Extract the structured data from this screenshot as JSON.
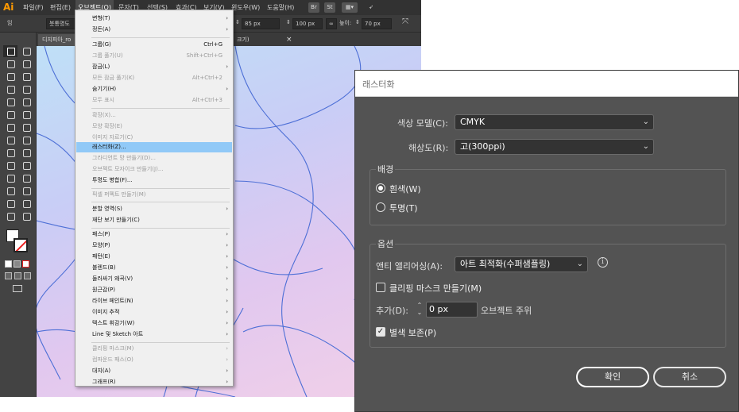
{
  "app": {
    "logo": "Ai"
  },
  "menubar": {
    "items": [
      "파일(F)",
      "편집(E)",
      "오브젝트(O)",
      "문자(T)",
      "선택(S)",
      "효과(C)",
      "보기(V)",
      "윈도우(W)",
      "도움말(H)"
    ],
    "icons": [
      "Br",
      "St"
    ]
  },
  "controlbar": {
    "label": "임",
    "brush": "붓통명도",
    "width_value": "85 px",
    "size_value": "100 px",
    "height_label": "높이:",
    "height_value": "70 px"
  },
  "tabs": {
    "doc_title": "디지피아_ro",
    "doc_suffix": "8)",
    "other_tab": "크기)"
  },
  "object_menu": {
    "items": [
      {
        "label": "변형(T)",
        "shortcut": "",
        "arrow": true,
        "disabled": false
      },
      {
        "label": "정돈(A)",
        "shortcut": "",
        "arrow": true,
        "disabled": false
      },
      {
        "label": "그룹(G)",
        "shortcut": "Ctrl+G",
        "arrow": false,
        "disabled": false
      },
      {
        "label": "그룹 풀기(U)",
        "shortcut": "Shift+Ctrl+G",
        "arrow": false,
        "disabled": true
      },
      {
        "label": "잠금(L)",
        "shortcut": "",
        "arrow": true,
        "disabled": false
      },
      {
        "label": "모든 잠금 풀기(K)",
        "shortcut": "Alt+Ctrl+2",
        "arrow": false,
        "disabled": true
      },
      {
        "label": "숨기기(H)",
        "shortcut": "",
        "arrow": true,
        "disabled": false
      },
      {
        "label": "모두 표시",
        "shortcut": "Alt+Ctrl+3",
        "arrow": false,
        "disabled": true
      },
      {
        "label": "확장(X)...",
        "shortcut": "",
        "arrow": false,
        "disabled": true
      },
      {
        "label": "모양 확장(E)",
        "shortcut": "",
        "arrow": false,
        "disabled": true
      },
      {
        "label": "이미지 자르기(C)",
        "shortcut": "",
        "arrow": false,
        "disabled": true
      },
      {
        "label": "래스터화(Z)...",
        "shortcut": "",
        "arrow": false,
        "disabled": false,
        "highlight": true
      },
      {
        "label": "그라디언트 망 만들기(D)...",
        "shortcut": "",
        "arrow": false,
        "disabled": true
      },
      {
        "label": "오브젝트 모자이크 만들기(J)...",
        "shortcut": "",
        "arrow": false,
        "disabled": true
      },
      {
        "label": "투명도 병합(F)...",
        "shortcut": "",
        "arrow": false,
        "disabled": false
      },
      {
        "label": "픽셀 퍼펙트 만들기(M)",
        "shortcut": "",
        "arrow": false,
        "disabled": true
      },
      {
        "label": "분할 영역(S)",
        "shortcut": "",
        "arrow": true,
        "disabled": false
      },
      {
        "label": "재단 보기 만들기(C)",
        "shortcut": "",
        "arrow": false,
        "disabled": false
      },
      {
        "label": "패스(P)",
        "shortcut": "",
        "arrow": true,
        "disabled": false
      },
      {
        "label": "모양(P)",
        "shortcut": "",
        "arrow": true,
        "disabled": false
      },
      {
        "label": "패턴(E)",
        "shortcut": "",
        "arrow": true,
        "disabled": false
      },
      {
        "label": "블렌드(B)",
        "shortcut": "",
        "arrow": true,
        "disabled": false
      },
      {
        "label": "둘러싸기 왜곡(V)",
        "shortcut": "",
        "arrow": true,
        "disabled": false
      },
      {
        "label": "원근감(P)",
        "shortcut": "",
        "arrow": true,
        "disabled": false
      },
      {
        "label": "라이브 페인트(N)",
        "shortcut": "",
        "arrow": true,
        "disabled": false
      },
      {
        "label": "이미지 추적",
        "shortcut": "",
        "arrow": true,
        "disabled": false
      },
      {
        "label": "텍스트 휘감기(W)",
        "shortcut": "",
        "arrow": true,
        "disabled": false
      },
      {
        "label": "Line 및 Sketch 아트",
        "shortcut": "",
        "arrow": true,
        "disabled": false
      },
      {
        "label": "클리핑 마스크(M)",
        "shortcut": "",
        "arrow": true,
        "disabled": true
      },
      {
        "label": "컴파운드 패스(O)",
        "shortcut": "",
        "arrow": true,
        "disabled": true
      },
      {
        "label": "대지(A)",
        "shortcut": "",
        "arrow": true,
        "disabled": false
      },
      {
        "label": "그래프(R)",
        "shortcut": "",
        "arrow": true,
        "disabled": false
      }
    ]
  },
  "dialog": {
    "title": "래스터화",
    "color_model_label": "색상 모델(C):",
    "color_model_value": "CMYK",
    "resolution_label": "해상도(R):",
    "resolution_value": "고(300ppi)",
    "background_title": "배경",
    "bg_white": "흰색(W)",
    "bg_transparent": "투명(T)",
    "options_title": "옵션",
    "antialias_label": "앤티 앨리어싱(A):",
    "antialias_value": "아트 최적화(수퍼샘플링)",
    "info_glyph": "i",
    "clipping_mask_label": "클리핑 마스크 만들기(M)",
    "add_label": "추가(D):",
    "add_value": "0 px",
    "add_suffix": "오브젝트 주위",
    "preserve_spot_label": "별색 보존(P)",
    "ok_label": "확인",
    "cancel_label": "취소"
  }
}
